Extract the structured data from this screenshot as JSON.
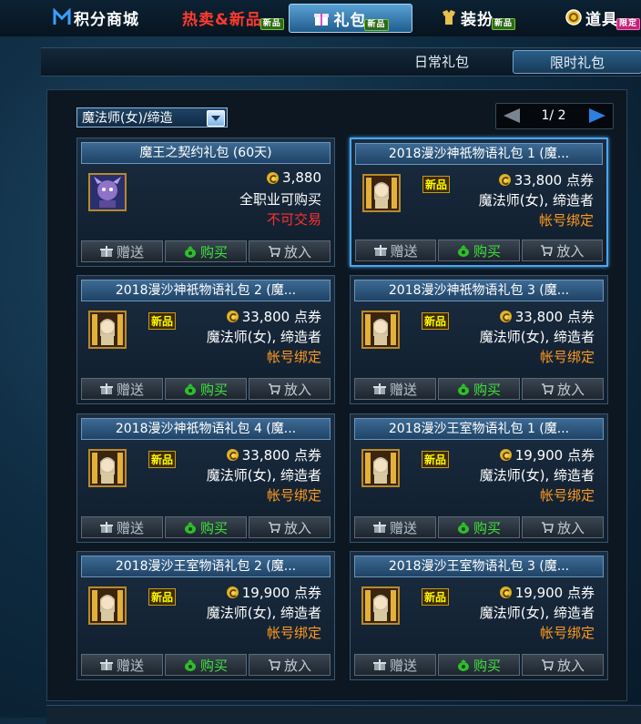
{
  "top_tabs": [
    {
      "label": "积分商城",
      "icon": "m-logo-icon",
      "new": ""
    },
    {
      "label": "热卖&新品",
      "icon": "",
      "new": "新品"
    },
    {
      "label": "礼包",
      "icon": "gift-icon",
      "new": "新品"
    },
    {
      "label": "装扮",
      "icon": "costume-icon",
      "new": "新品"
    },
    {
      "label": "道具",
      "icon": "coin-icon",
      "new": "限定"
    }
  ],
  "sub_tabs": [
    "日常礼包",
    "限时礼包"
  ],
  "filter": {
    "value": "魔法师(女)/缔造"
  },
  "pager": {
    "text": "1/ 2"
  },
  "actions": {
    "gift": "赠送",
    "buy": "购买",
    "cart": "放入"
  },
  "new_badge": "新品",
  "colors": {
    "accent": "#4aa6ee",
    "buy": "#3fe03a",
    "bind": "#ff9a1f",
    "no_trade": "#ff3030"
  },
  "cards": [
    {
      "title": "魔王之契约礼包 (60天)",
      "price": "3,880",
      "line2": "全职业可购买",
      "line3": "不可交易",
      "line3_color": "#ff3030",
      "is_new": false,
      "icon": "demon-portrait-icon"
    },
    {
      "title": "2018漫沙神祇物语礼包 1 (魔...",
      "price": "33,800 点券",
      "line2": "魔法师(女), 缔造者",
      "line3": "帐号绑定",
      "line3_color": "#ff9a1f",
      "is_new": true,
      "icon": "mage-portrait-icon"
    },
    {
      "title": "2018漫沙神祇物语礼包 2 (魔...",
      "price": "33,800 点券",
      "line2": "魔法师(女), 缔造者",
      "line3": "帐号绑定",
      "line3_color": "#ff9a1f",
      "is_new": true,
      "icon": "mage-portrait-icon"
    },
    {
      "title": "2018漫沙神祇物语礼包 3 (魔...",
      "price": "33,800 点券",
      "line2": "魔法师(女), 缔造者",
      "line3": "帐号绑定",
      "line3_color": "#ff9a1f",
      "is_new": true,
      "icon": "mage-portrait-icon"
    },
    {
      "title": "2018漫沙神祇物语礼包 4 (魔...",
      "price": "33,800 点券",
      "line2": "魔法师(女), 缔造者",
      "line3": "帐号绑定",
      "line3_color": "#ff9a1f",
      "is_new": true,
      "icon": "mage-portrait-icon"
    },
    {
      "title": "2018漫沙王室物语礼包 1 (魔...",
      "price": "19,900 点券",
      "line2": "魔法师(女), 缔造者",
      "line3": "帐号绑定",
      "line3_color": "#ff9a1f",
      "is_new": true,
      "icon": "mage-portrait-icon"
    },
    {
      "title": "2018漫沙王室物语礼包 2 (魔...",
      "price": "19,900 点券",
      "line2": "魔法师(女), 缔造者",
      "line3": "帐号绑定",
      "line3_color": "#ff9a1f",
      "is_new": true,
      "icon": "mage-portrait-icon"
    },
    {
      "title": "2018漫沙王室物语礼包 3 (魔...",
      "price": "19,900 点券",
      "line2": "魔法师(女), 缔造者",
      "line3": "帐号绑定",
      "line3_color": "#ff9a1f",
      "is_new": true,
      "icon": "mage-portrait-icon"
    }
  ]
}
